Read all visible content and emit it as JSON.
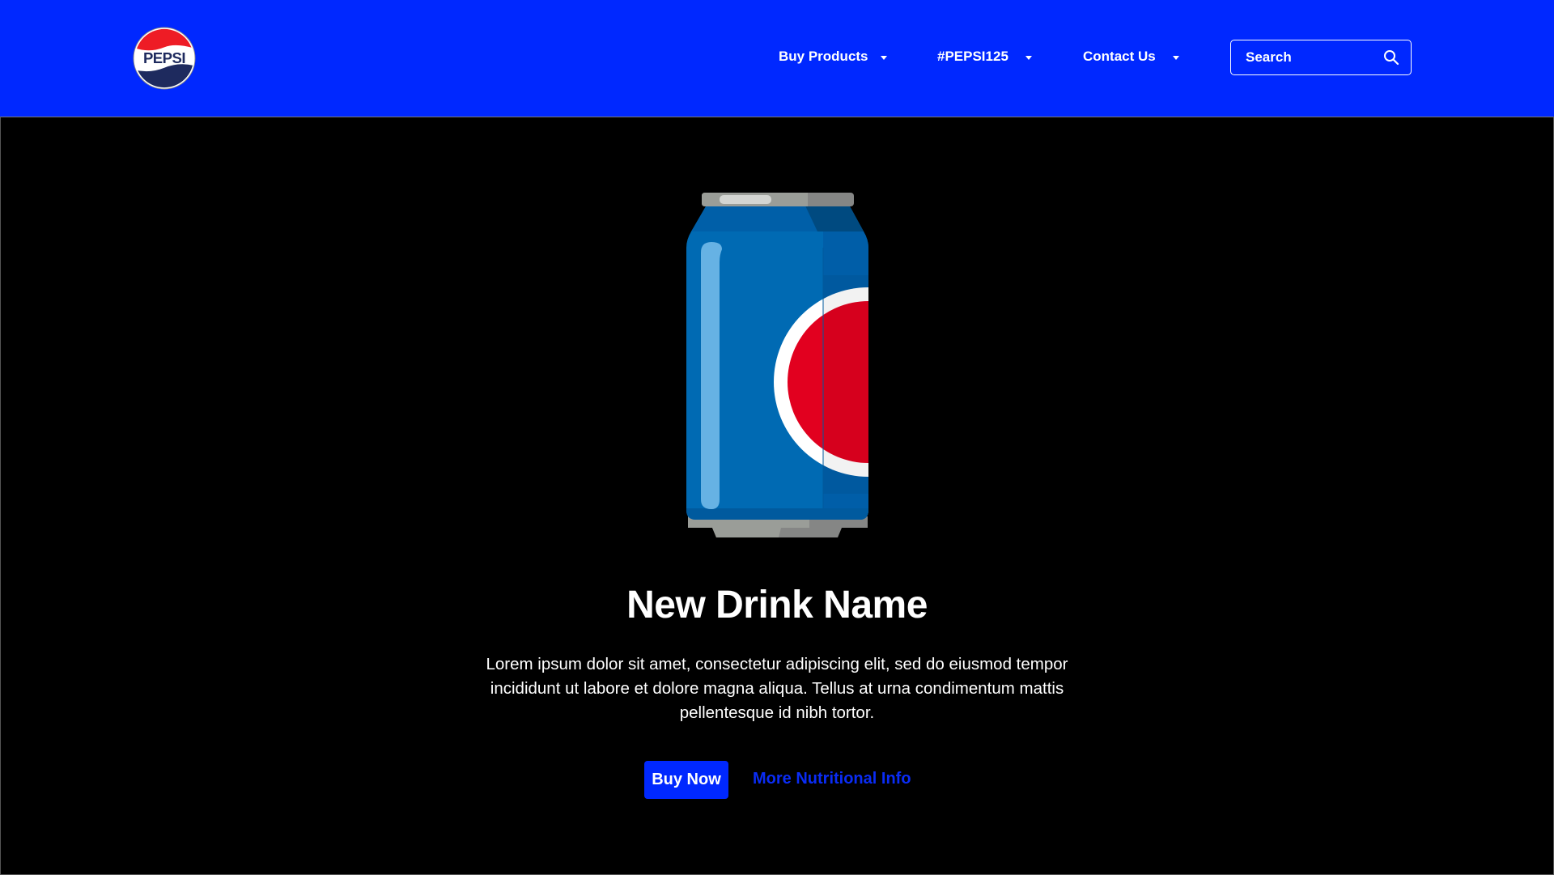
{
  "header": {
    "logo_text": "PEPSI",
    "nav": [
      {
        "label": "Buy Products"
      },
      {
        "label": "#PEPSI125"
      },
      {
        "label": "Contact Us"
      }
    ],
    "search": {
      "placeholder": "Search"
    }
  },
  "hero": {
    "title": "New Drink Name",
    "description": "Lorem ipsum dolor sit amet, consectetur adipiscing elit, sed do eiusmod tempor incididunt ut labore et dolore magna aliqua. Tellus at urna condimentum mattis pellentesque id nibh tortor.",
    "buy_label": "Buy Now",
    "more_label": "More Nutritional Info"
  },
  "colors": {
    "brand_blue": "#0028ff",
    "can_blue": "#006ab3",
    "can_red": "#e2001f"
  }
}
